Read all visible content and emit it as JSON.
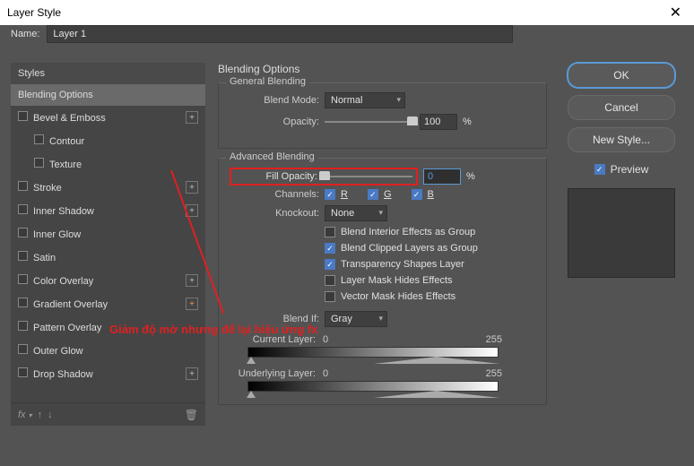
{
  "window": {
    "title": "Layer Style",
    "close": "✕"
  },
  "name": {
    "label": "Name:",
    "value": "Layer 1"
  },
  "styles": {
    "header": "Styles",
    "items": [
      {
        "label": "Blending Options",
        "selected": true
      },
      {
        "label": "Bevel & Emboss",
        "fx": "+"
      },
      {
        "label": "Contour",
        "indent": true
      },
      {
        "label": "Texture",
        "indent": true
      },
      {
        "label": "Stroke",
        "fx": "+"
      },
      {
        "label": "Inner Shadow",
        "fx": "+"
      },
      {
        "label": "Inner Glow"
      },
      {
        "label": "Satin"
      },
      {
        "label": "Color Overlay",
        "fx": "+"
      },
      {
        "label": "Gradient Overlay",
        "fx": "+",
        "special": true
      },
      {
        "label": "Pattern Overlay"
      },
      {
        "label": "Outer Glow"
      },
      {
        "label": "Drop Shadow",
        "fx": "+"
      }
    ],
    "footer_fx": "fx"
  },
  "blending": {
    "title": "Blending Options",
    "general": {
      "legend": "General Blending",
      "blend_mode_label": "Blend Mode:",
      "blend_mode_value": "Normal",
      "opacity_label": "Opacity:",
      "opacity_value": "100",
      "opacity_unit": "%"
    },
    "advanced": {
      "legend": "Advanced Blending",
      "fill_opacity_label": "Fill Opacity:",
      "fill_opacity_value": "0",
      "fill_opacity_unit": "%",
      "channels_label": "Channels:",
      "ch_r": "R",
      "ch_g": "G",
      "ch_b": "B",
      "knockout_label": "Knockout:",
      "knockout_value": "None",
      "opts": {
        "interior": "Blend Interior Effects as Group",
        "clipped": "Blend Clipped Layers as Group",
        "transparency": "Transparency Shapes Layer",
        "layer_mask": "Layer Mask Hides Effects",
        "vector_mask": "Vector Mask Hides Effects"
      },
      "blend_if_label": "Blend If:",
      "blend_if_value": "Gray",
      "current_layer_label": "Current Layer:",
      "underlying_label": "Underlying Layer:",
      "val_lo": "0",
      "val_hi": "255"
    }
  },
  "actions": {
    "ok": "OK",
    "cancel": "Cancel",
    "new_style": "New Style...",
    "preview": "Preview"
  },
  "annotation": {
    "text": "Giảm độ mờ nhưng để lại hiệu ứng fx"
  }
}
